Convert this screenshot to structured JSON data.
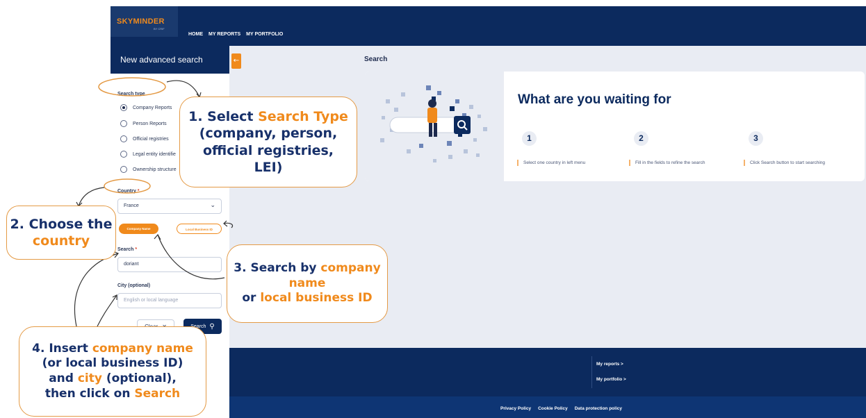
{
  "app": {
    "logo_text": "SKYMINDER",
    "logo_sub": "BY CRIF",
    "nav": [
      "HOME",
      "MY REPORTS",
      "MY PORTFOLIO"
    ]
  },
  "sidebar": {
    "title": "New advanced search",
    "collapse_icon": "←",
    "search_type_label": "Search type",
    "search_types": [
      {
        "label": "Company Reports",
        "selected": true
      },
      {
        "label": "Person Reports",
        "selected": false
      },
      {
        "label": "Official registries",
        "selected": false
      },
      {
        "label": "Legal entity identifie",
        "selected": false
      },
      {
        "label": "Ownership structure",
        "selected": false
      }
    ],
    "country_label": "Country",
    "required_mark": "*",
    "country_value": "France",
    "chevron": "⌄",
    "toggle_company_name": "Company Name",
    "toggle_local_business_id": "Local Business ID",
    "search_label": "Search",
    "search_value": "doriant",
    "city_label": "City (optional)",
    "city_placeholder": "English or local language",
    "clear_label": "Clear",
    "clear_icon": "✕",
    "search_button_label": "Search",
    "search_button_icon": "⚲"
  },
  "main": {
    "title": "Search",
    "hero_heading": "What are you waiting for",
    "steps": [
      {
        "num": "1",
        "text": "Select one country in left menu"
      },
      {
        "num": "2",
        "text": "Fill in the fields to refine the search"
      },
      {
        "num": "3",
        "text": "Click Search button to start searching"
      }
    ]
  },
  "footer": {
    "links": [
      "My reports >",
      "My portfolio >"
    ],
    "policy_links": [
      "Privacy Policy",
      "Cookie Policy",
      "Data protection policy"
    ]
  },
  "annotations": {
    "step1": {
      "prefix": "1. Select ",
      "highlight": "Search Type",
      "line2": "(company, person,",
      "line3": "official registries,",
      "line4": "LEI)"
    },
    "step2": {
      "line1": "2. Choose the",
      "highlight": "country"
    },
    "step3": {
      "prefix": "3. Search by ",
      "highlight1": "company",
      "highlight1b": "name",
      "or_text": "or ",
      "highlight2": "local business ID"
    },
    "step4": {
      "prefix": "4. Insert ",
      "highlight1": "company name",
      "line2": "(or local business ID)",
      "and_text": "and ",
      "highlight2": "city",
      "optional_text": " (optional),",
      "then_text": "then click on ",
      "highlight3": "Search"
    }
  },
  "colors": {
    "navy": "#0c2a5e",
    "orange": "#f08a1c",
    "background": "#e9ecf3",
    "callout_text": "#17306a"
  }
}
